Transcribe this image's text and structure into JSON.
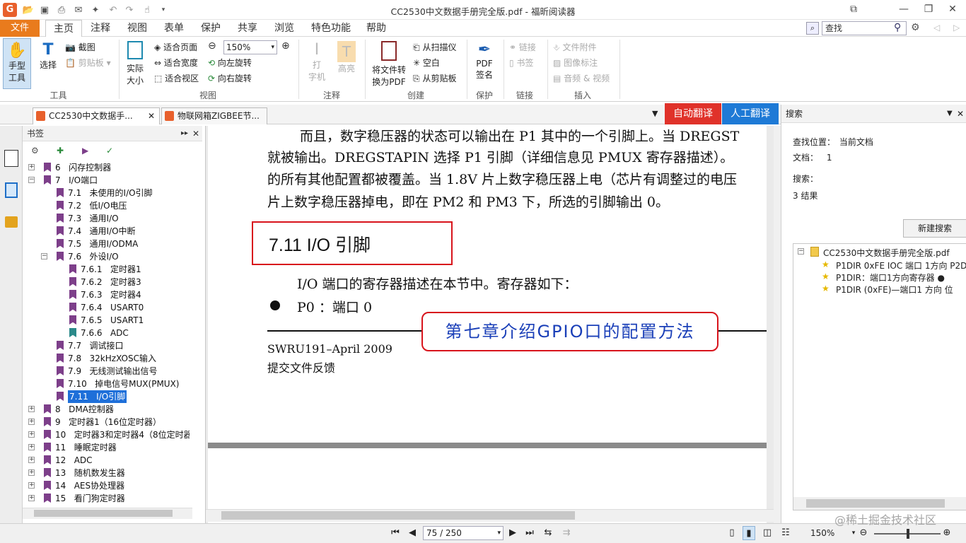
{
  "window": {
    "title": "CC2530中文数据手册完全版.pdf - 福昕阅读器"
  },
  "menu": {
    "file": "文件",
    "tabs": [
      "主页",
      "注释",
      "视图",
      "表单",
      "保护",
      "共享",
      "浏览",
      "特色功能",
      "帮助"
    ],
    "search_placeholder": "查找"
  },
  "ribbon": {
    "tools": {
      "hand_line1": "手型",
      "hand_line2": "工具",
      "select": "选择",
      "screenshot": "截图",
      "clipboard": "剪贴板",
      "group": "工具"
    },
    "view": {
      "actual_line1": "实际",
      "actual_line2": "大小",
      "fit_page": "适合页面",
      "fit_width": "适合宽度",
      "fit_visible": "适合视区",
      "zoom": "150%",
      "rotate_left": "向左旋转",
      "rotate_right": "向右旋转",
      "group": "视图"
    },
    "comment": {
      "typewriter_line1": "打",
      "typewriter_line2": "字机",
      "highlight": "高亮",
      "group": "注释"
    },
    "create": {
      "convert_line1": "将文件转",
      "convert_line2": "换为PDF",
      "from_scanner": "从扫描仪",
      "blank": "空白",
      "from_clipboard": "从剪贴板",
      "group": "创建"
    },
    "protect": {
      "sign_line1": "PDF",
      "sign_line2": "签名",
      "group": "保护"
    },
    "link": {
      "link": "链接",
      "bookmark": "书签",
      "group": "链接"
    },
    "insert": {
      "attachment": "文件附件",
      "image_annot": "图像标注",
      "audio_video": "音频 & 视频",
      "group": "插入"
    }
  },
  "doc_tabs": [
    {
      "label": "CC2530中文数据手..."
    },
    {
      "label": "物联网箱ZIGBEE节..."
    }
  ],
  "translate": {
    "auto": "自动翻译",
    "human": "人工翻译"
  },
  "bookmarks": {
    "title": "书签",
    "items": [
      {
        "label": "6   闪存控制器"
      },
      {
        "label": "7   I/O端口"
      },
      {
        "label": "7.1   未使用的I/O引脚"
      },
      {
        "label": "7.2   低I/O电压"
      },
      {
        "label": "7.3   通用I/O"
      },
      {
        "label": "7.4   通用I/O中断"
      },
      {
        "label": "7.5   通用I/ODMA"
      },
      {
        "label": "7.6   外设I/O"
      },
      {
        "label": "7.6.1   定时器1"
      },
      {
        "label": "7.6.2   定时器3"
      },
      {
        "label": "7.6.3   定时器4"
      },
      {
        "label": "7.6.4   USART0"
      },
      {
        "label": "7.6.5   USART1"
      },
      {
        "label": "7.6.6   ADC"
      },
      {
        "label": "7.7   调试接口"
      },
      {
        "label": "7.8   32kHzXOSC输入"
      },
      {
        "label": "7.9   无线测试输出信号"
      },
      {
        "label": "7.10   掉电信号MUX(PMUX)"
      },
      {
        "label": "7.11   I/O引脚"
      },
      {
        "label": "8   DMA控制器"
      },
      {
        "label": "9   定时器1（16位定时器）"
      },
      {
        "label": "10   定时器3和定时器4（8位定时器）"
      },
      {
        "label": "11   睡眠定时器"
      },
      {
        "label": "12   ADC"
      },
      {
        "label": "13   随机数发生器"
      },
      {
        "label": "14   AES协处理器"
      },
      {
        "label": "15   看门狗定时器"
      }
    ]
  },
  "page": {
    "line1": "而且，数字稳压器的状态可以输出在 P1 其中的一个引脚上。当 DREGST",
    "line2": "就被输出。DREGSTAPIN 选择 P1 引脚（详细信息见 PMUX 寄存器描述）。",
    "line3": "的所有其他配置都被覆盖。当 1.8V 片上数字稳压器上电（芯片有调整过的电压",
    "line4": "片上数字稳压器掉电，即在 PM2 和 PM3 下，所选的引脚输出 0。",
    "section_title": "7.11   I/O 引脚",
    "intro": "I/O 端口的寄存器描述在本节中。寄存器如下：",
    "bullet": "P0 ：端口 0",
    "footer_doc": "SWRU191–April 2009",
    "footer_feedback": "提交文件反馈",
    "annotation": "第七章介绍GPIO口的配置方法"
  },
  "search_panel": {
    "title": "搜索",
    "location_label": "查找位置：",
    "location_value": "当前文档",
    "doc_label": "文档：",
    "doc_value": "1",
    "search_label": "搜索：",
    "results_count": "3 结果",
    "new_search": "新建搜索",
    "file": "CC2530中文数据手册完全版.pdf",
    "results": [
      "P1DIR 0xFE IOC 端口 1方向 P2DI",
      "P1DIR：端口1方向寄存器 ●",
      "P1DIR (0xFE)—端口1 方向 位"
    ]
  },
  "status": {
    "page": "75 / 250",
    "zoom": "150%"
  },
  "watermark": "@稀土掘金技术社区"
}
